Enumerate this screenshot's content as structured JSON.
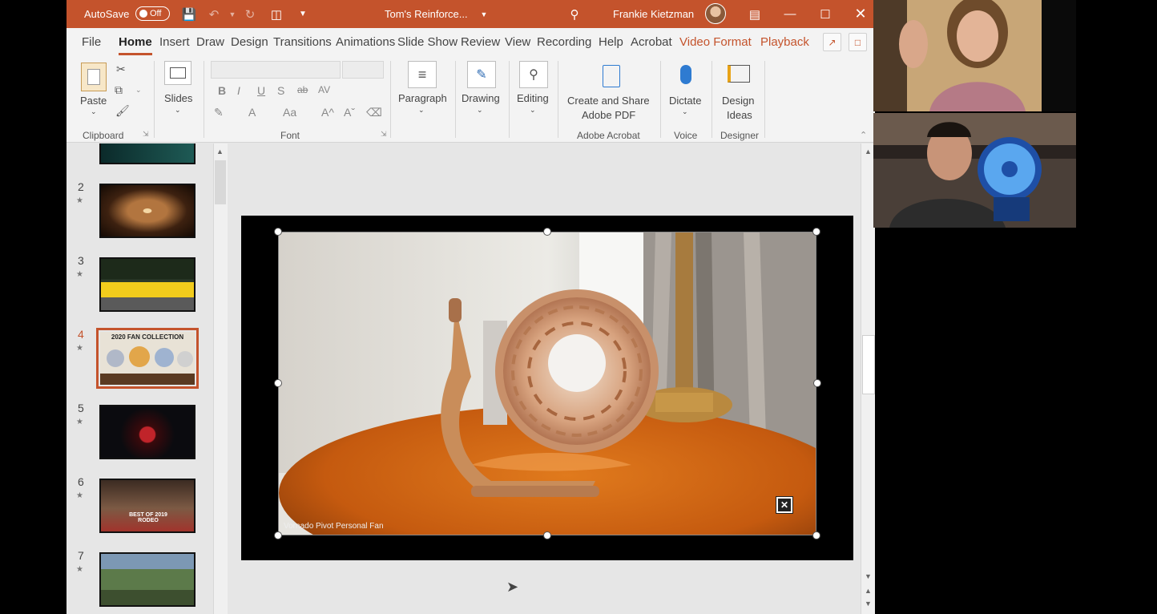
{
  "titlebar": {
    "autosave_label": "AutoSave",
    "autosave_state": "Off",
    "doc_title": "Tom's Reinforce...",
    "user_name": "Frankie Kietzman"
  },
  "tabs": [
    "File",
    "Home",
    "Insert",
    "Draw",
    "Design",
    "Transitions",
    "Animations",
    "Slide Show",
    "Review",
    "View",
    "Recording",
    "Help",
    "Acrobat",
    "Video Format",
    "Playback"
  ],
  "ribbon": {
    "paste": "Paste",
    "clipboard": "Clipboard",
    "slides": "Slides",
    "font": "Font",
    "paragraph": "Paragraph",
    "drawing": "Drawing",
    "editing": "Editing",
    "create_share_1": "Create and Share",
    "create_share_2": "Adobe PDF",
    "adobe_acrobat": "Adobe Acrobat",
    "dictate": "Dictate",
    "voice": "Voice",
    "design_ideas_1": "Design",
    "design_ideas_2": "Ideas",
    "designer": "Designer"
  },
  "thumbnails": [
    {
      "num": "2"
    },
    {
      "num": "3"
    },
    {
      "num": "4",
      "title": "2020 FAN COLLECTION"
    },
    {
      "num": "5"
    },
    {
      "num": "6",
      "caption": "BEST OF 2019 RODEO"
    },
    {
      "num": "7"
    }
  ],
  "video_caption": "Vornado Pivot Personal Fan",
  "colors": {
    "accent": "#c4532c",
    "ribbon_bg": "#f3f3f3",
    "workspace_bg": "#e6e6e6"
  }
}
